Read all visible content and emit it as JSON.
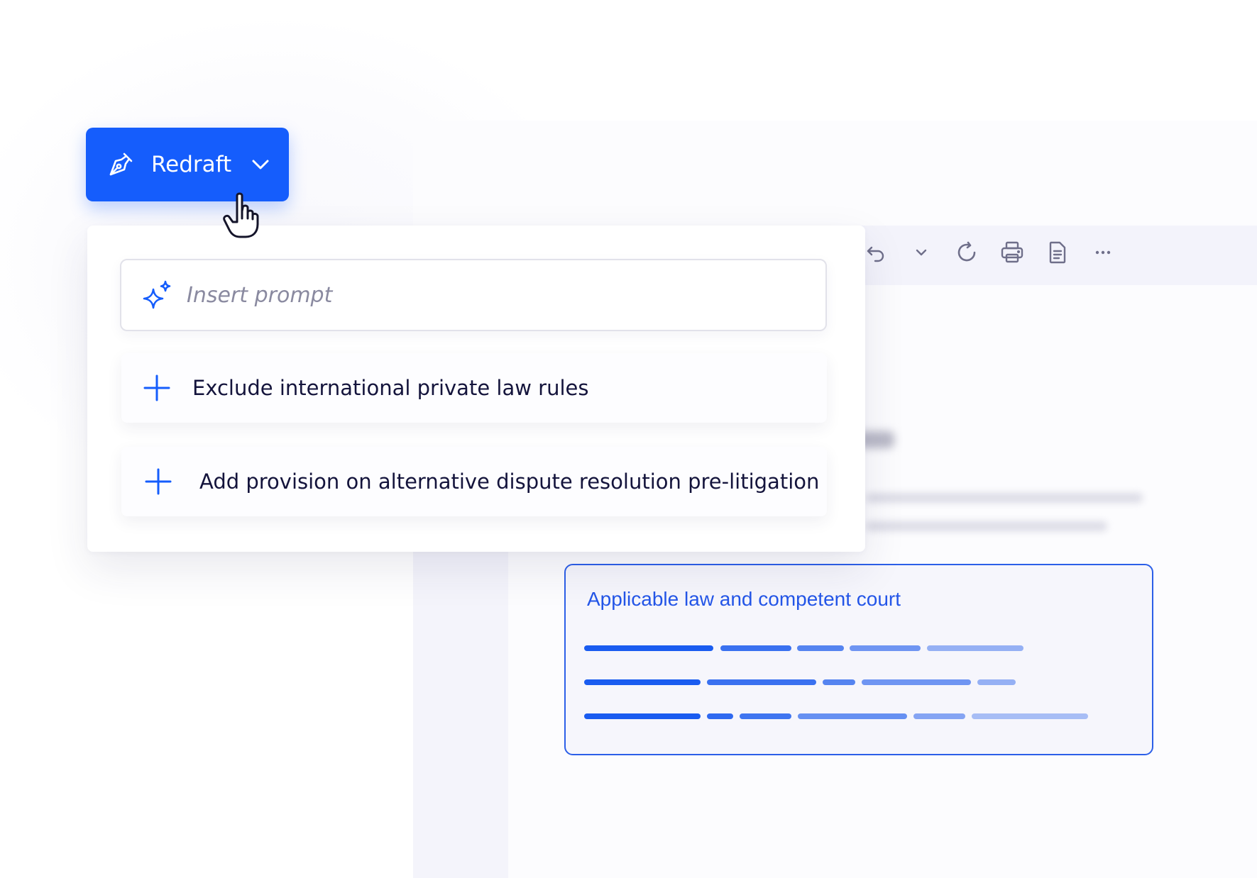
{
  "redraft_button": {
    "label": "Redraft",
    "icon": "pen-icon",
    "dropdown_icon": "chevron-down-icon"
  },
  "prompt": {
    "placeholder": "Insert prompt",
    "icon": "sparkle-icon"
  },
  "suggestions": [
    {
      "label": "Exclude international private law rules",
      "icon": "plus-icon"
    },
    {
      "label": "Add provision on alternative dispute resolution pre-litigation",
      "icon": "plus-icon"
    }
  ],
  "toolbar": {
    "icons": [
      "undo-icon",
      "chevron-down-icon",
      "refresh-icon",
      "print-icon",
      "document-icon",
      "more-icon"
    ]
  },
  "clause": {
    "title": "Applicable law and competent court"
  },
  "colors": {
    "accent": "#155dfc",
    "clause_border": "#2c5fe8",
    "text_dark": "#14143c",
    "placeholder": "#8a8aa0"
  }
}
